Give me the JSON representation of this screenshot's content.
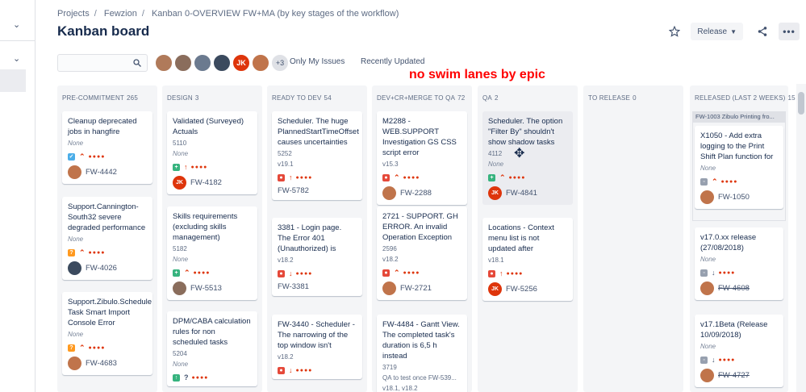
{
  "breadcrumb": [
    "Projects",
    "Fewzion",
    "Kanban 0-OVERVIEW FW+MA (by key stages of the workflow)"
  ],
  "page_title": "Kanban board",
  "header": {
    "release_label": "Release",
    "more_label": "•••"
  },
  "search": {
    "placeholder": ""
  },
  "avatars": {
    "initials": "JK",
    "more": "+3"
  },
  "quick_filters": [
    "Only My Issues",
    "Recently Updated"
  ],
  "annotation": "no swim lanes by epic",
  "columns": [
    {
      "title": "PRE-COMMITMENT",
      "count": "265",
      "cards": [
        {
          "summary": "Cleanup deprecated jobs in hangfire",
          "fields": [
            "None"
          ],
          "key": "FW-4442"
        },
        {
          "summary": "Support.Cannington-South32 severe degraded performance",
          "fields": [
            "None"
          ],
          "key": "FW-4026"
        },
        {
          "summary": "Support.Zibulo.Schedule Task Smart Import Console Error",
          "fields": [
            "None"
          ],
          "key": "FW-4683"
        }
      ]
    },
    {
      "title": "DESIGN",
      "count": "3",
      "cards": [
        {
          "summary": "Validated (Surveyed) Actuals",
          "fields": [
            "5110",
            "None"
          ],
          "key": "FW-4182"
        },
        {
          "summary": "Skills requirements (excluding skills management)",
          "fields": [
            "5182",
            "None"
          ],
          "key": "FW-5513"
        },
        {
          "summary": "DPM/CABA calculation rules for non scheduled tasks",
          "fields": [
            "5204",
            "None"
          ],
          "key": ""
        }
      ]
    },
    {
      "title": "READY TO DEV",
      "count": "54",
      "cards": [
        {
          "summary": "Scheduler. The huge PlannedStartTimeOffset causes uncertainties",
          "fields": [
            "5252",
            "v19.1"
          ],
          "key": "FW-5782"
        },
        {
          "summary": "3381 - Login page. The Error 401 (Unauthorized) is",
          "fields": [
            "v18.2"
          ],
          "key": "FW-3381"
        },
        {
          "summary": "FW-3440 - Scheduler - The narrowing of the top window isn't",
          "fields": [
            "v18.2"
          ],
          "key": ""
        }
      ]
    },
    {
      "title": "DEV+CR+MERGE TO QA",
      "count": "72",
      "cards": [
        {
          "summary": "M2288 - WEB.SUPPORT Investigation GS CSS script error",
          "fields": [
            "v15.3"
          ],
          "key": "FW-2288"
        },
        {
          "summary": "2721 - SUPPORT. GH ERROR. An invalid Operation Exception",
          "fields": [
            "2596",
            "v18.2"
          ],
          "key": "FW-2721"
        },
        {
          "summary": "FW-4484 - Gantt View. The completed task's duration is 6,5 h instead",
          "fields": [
            "3719",
            "QA to test once FW-539...",
            "v18.1, v18.2"
          ],
          "key": ""
        }
      ]
    },
    {
      "title": "QA",
      "count": "2",
      "cards": [
        {
          "summary": "Scheduler. The option \"Filter By\" shouldn't show shadow tasks",
          "fields": [
            "4112",
            "None"
          ],
          "key": "FW-4841"
        },
        {
          "summary": "Locations - Context menu list is not updated after",
          "fields": [
            "v18.1"
          ],
          "key": "FW-5256"
        }
      ]
    },
    {
      "title": "TO RELEASE",
      "count": "0",
      "cards": []
    },
    {
      "title": "RELEASED (LAST 2 WEEKS)",
      "count": "15",
      "epic": "FW-1003 Zibulo Printing fro...",
      "cards": [
        {
          "summary": "X1050 - Add extra logging to the Print Shift Plan function for",
          "fields": [
            "None"
          ],
          "key": "FW-1050"
        },
        {
          "summary": "v17.0.xx release (27/08/2018)",
          "fields": [
            "None"
          ],
          "key": "FW-4608"
        },
        {
          "summary": "v17.1Beta (Release 10/09/2018)",
          "fields": [
            "None"
          ],
          "key": "FW-4727"
        }
      ]
    }
  ],
  "colors": {
    "accent": "#0052cc",
    "annotation": "#ff0000",
    "priority": "#de350b",
    "story": "#36b37e",
    "bug": "#e5493a",
    "task": "#4bade8",
    "improvement": "#ff991f"
  }
}
